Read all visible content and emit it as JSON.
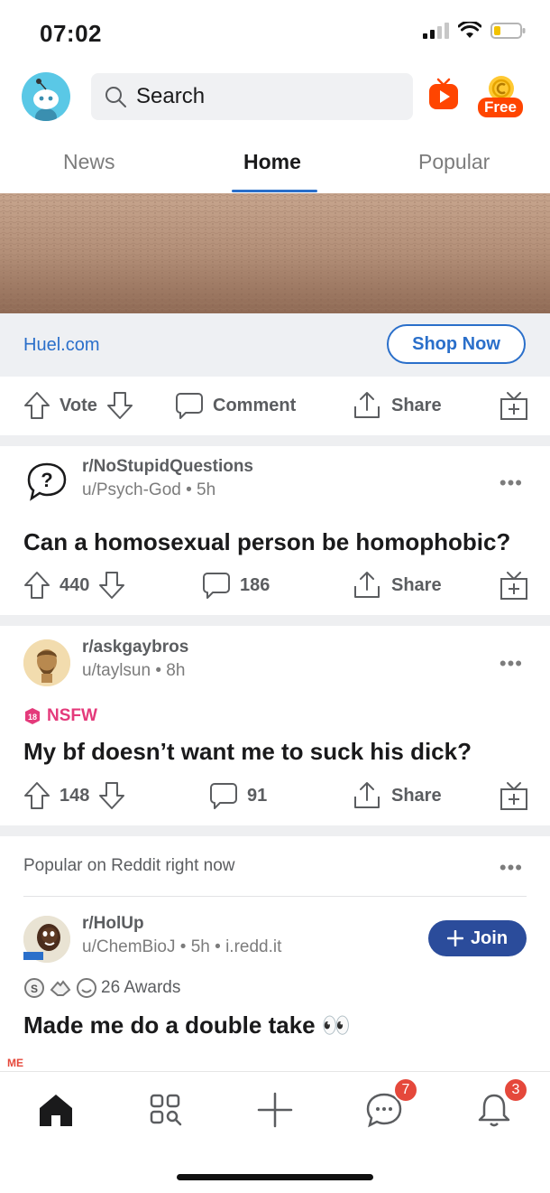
{
  "status": {
    "time": "07:02"
  },
  "search": {
    "placeholder": "Search"
  },
  "coin": {
    "badge": "Free"
  },
  "tabs": [
    {
      "label": "News"
    },
    {
      "label": "Home"
    },
    {
      "label": "Popular"
    }
  ],
  "ad": {
    "domain": "Huel.com",
    "cta": "Shop Now",
    "actions": {
      "vote": "Vote",
      "comment": "Comment",
      "share": "Share"
    }
  },
  "posts": [
    {
      "subreddit": "r/NoStupidQuestions",
      "user": "u/Psych-God",
      "age": "5h",
      "title": "Can a homosexual person be homophobic?",
      "votes": "440",
      "comments": "186",
      "share": "Share"
    },
    {
      "subreddit": "r/askgaybros",
      "user": "u/taylsun",
      "age": "8h",
      "nsfw": "NSFW",
      "nsfw_icon": "18",
      "title": "My bf doesn’t want me to suck his dick?",
      "votes": "148",
      "comments": "91",
      "share": "Share"
    }
  ],
  "popular": {
    "label": "Popular on Reddit right now",
    "subreddit": "r/HolUp",
    "user": "u/ChemBioJ",
    "age": "5h",
    "domain": "i.redd.it",
    "join": "Join",
    "awards": "26 Awards",
    "title": "Made me do a double take 👀"
  },
  "nav": {
    "chat_badge": "7",
    "inbox_badge": "3"
  },
  "colors": {
    "accent_blue": "#2a6fca",
    "join_blue": "#2b4c9b",
    "orange": "#ff4500",
    "nsfw_pink": "#e43a7b",
    "badge_red": "#e5483b"
  }
}
